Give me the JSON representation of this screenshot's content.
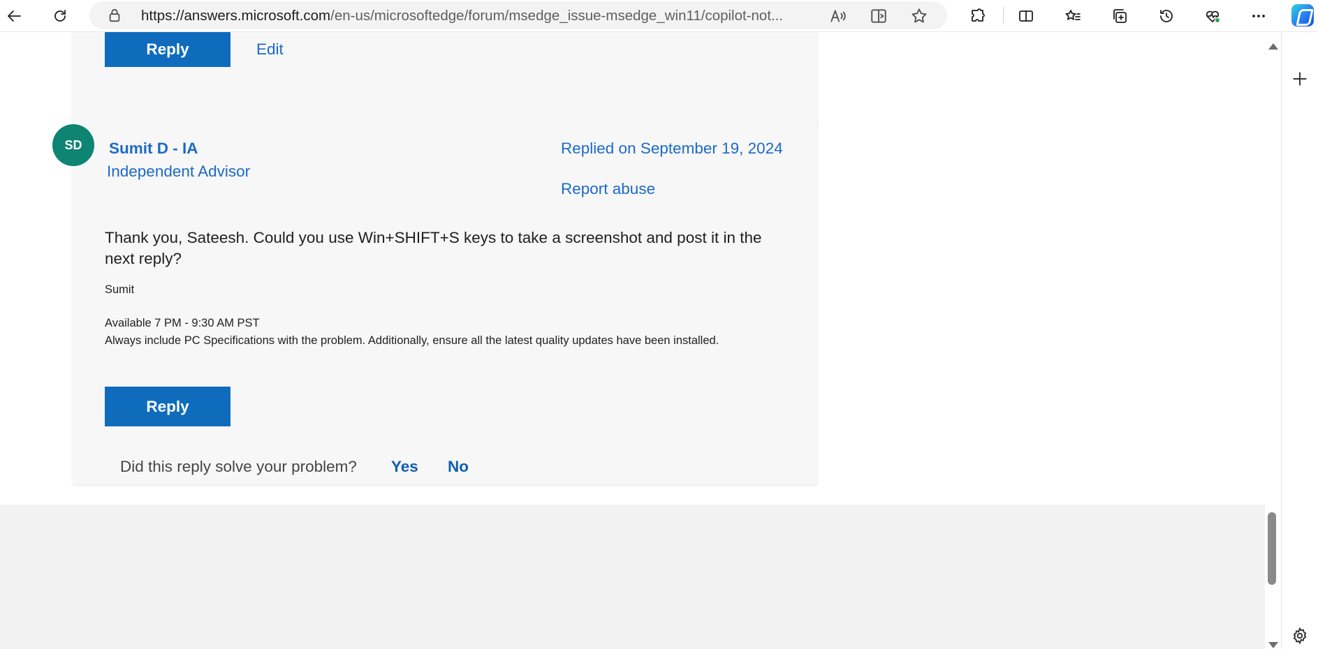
{
  "browser": {
    "url_host": "https://answers.microsoft.com",
    "url_path": "/en-us/microsoftedge/forum/msedge_issue-msedge_win11/copilot-not..."
  },
  "previous_reply": {
    "reply_label": "Reply",
    "edit_label": "Edit"
  },
  "post": {
    "avatar_initials": "SD",
    "author": "Sumit D - IA",
    "role": "Independent Advisor",
    "date": "Replied on September 19, 2024",
    "report": "Report abuse",
    "body": "Thank you, Sateesh. Could you use Win+SHIFT+S keys to take a screenshot and post it in the next reply?",
    "signature_name": "Sumit",
    "availability": "Available 7 PM - 9:30 AM PST",
    "note": "Always include PC Specifications with the problem. Additionally, ensure all the latest quality updates have been installed.",
    "reply_label": "Reply",
    "question": "Did this reply solve your problem?",
    "yes": "Yes",
    "no": "No"
  },
  "colors": {
    "accent": "#0f6cbd",
    "link": "#1b6ac9",
    "avatar": "#0e8472",
    "card_bg": "#f7f7f7"
  }
}
